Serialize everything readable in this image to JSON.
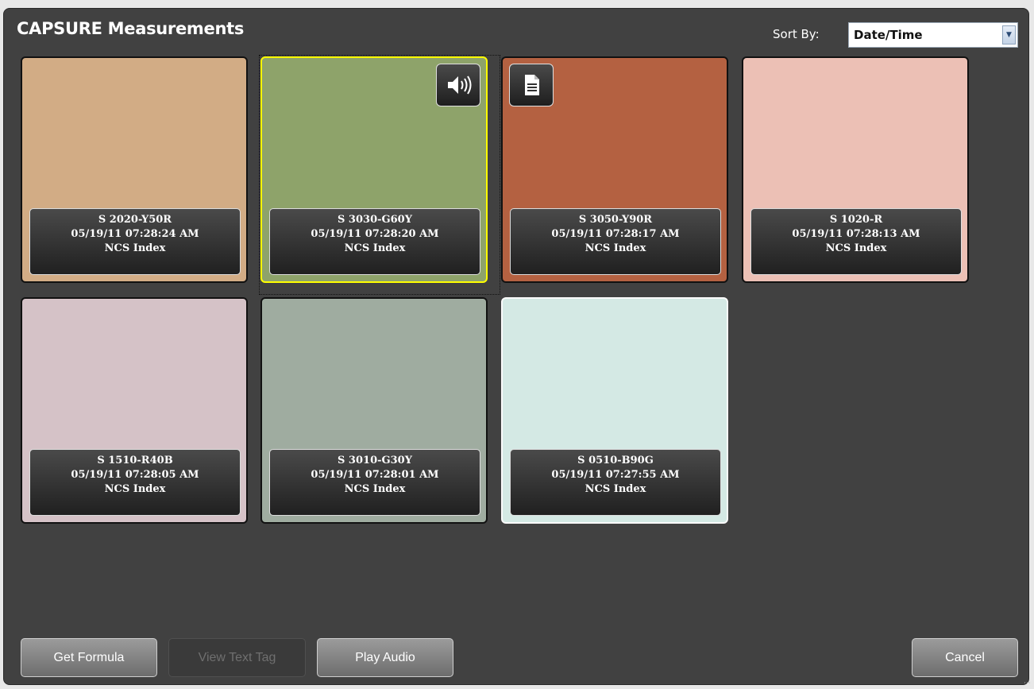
{
  "title": "CAPSURE Measurements",
  "sort": {
    "label": "Sort By:",
    "value": "Date/Time"
  },
  "tiles": [
    {
      "code": "S 2020-Y50R",
      "datetime": "05/19/11 07:28:24 AM",
      "index": "NCS Index",
      "color": "#d2ac85"
    },
    {
      "code": "S 3030-G60Y",
      "datetime": "05/19/11 07:28:20 AM",
      "index": "NCS Index",
      "color": "#8ea36a"
    },
    {
      "code": "S 3050-Y90R",
      "datetime": "05/19/11 07:28:17 AM",
      "index": "NCS Index",
      "color": "#b46141"
    },
    {
      "code": "S 1020-R",
      "datetime": "05/19/11 07:28:13 AM",
      "index": "NCS Index",
      "color": "#ecc0b5"
    },
    {
      "code": "S 1510-R40B",
      "datetime": "05/19/11 07:28:05 AM",
      "index": "NCS Index",
      "color": "#d5c2c7"
    },
    {
      "code": "S 3010-G30Y",
      "datetime": "05/19/11 07:28:01 AM",
      "index": "NCS Index",
      "color": "#9facA0"
    },
    {
      "code": "S 0510-B90G",
      "datetime": "05/19/11 07:27:55 AM",
      "index": "NCS Index",
      "color": "#d4e9e4"
    }
  ],
  "icons": {
    "audio": "speaker-icon",
    "note": "document-icon"
  },
  "buttons": {
    "get_formula": "Get Formula",
    "view_text_tag": "View Text Tag",
    "play_audio": "Play Audio",
    "cancel": "Cancel"
  }
}
